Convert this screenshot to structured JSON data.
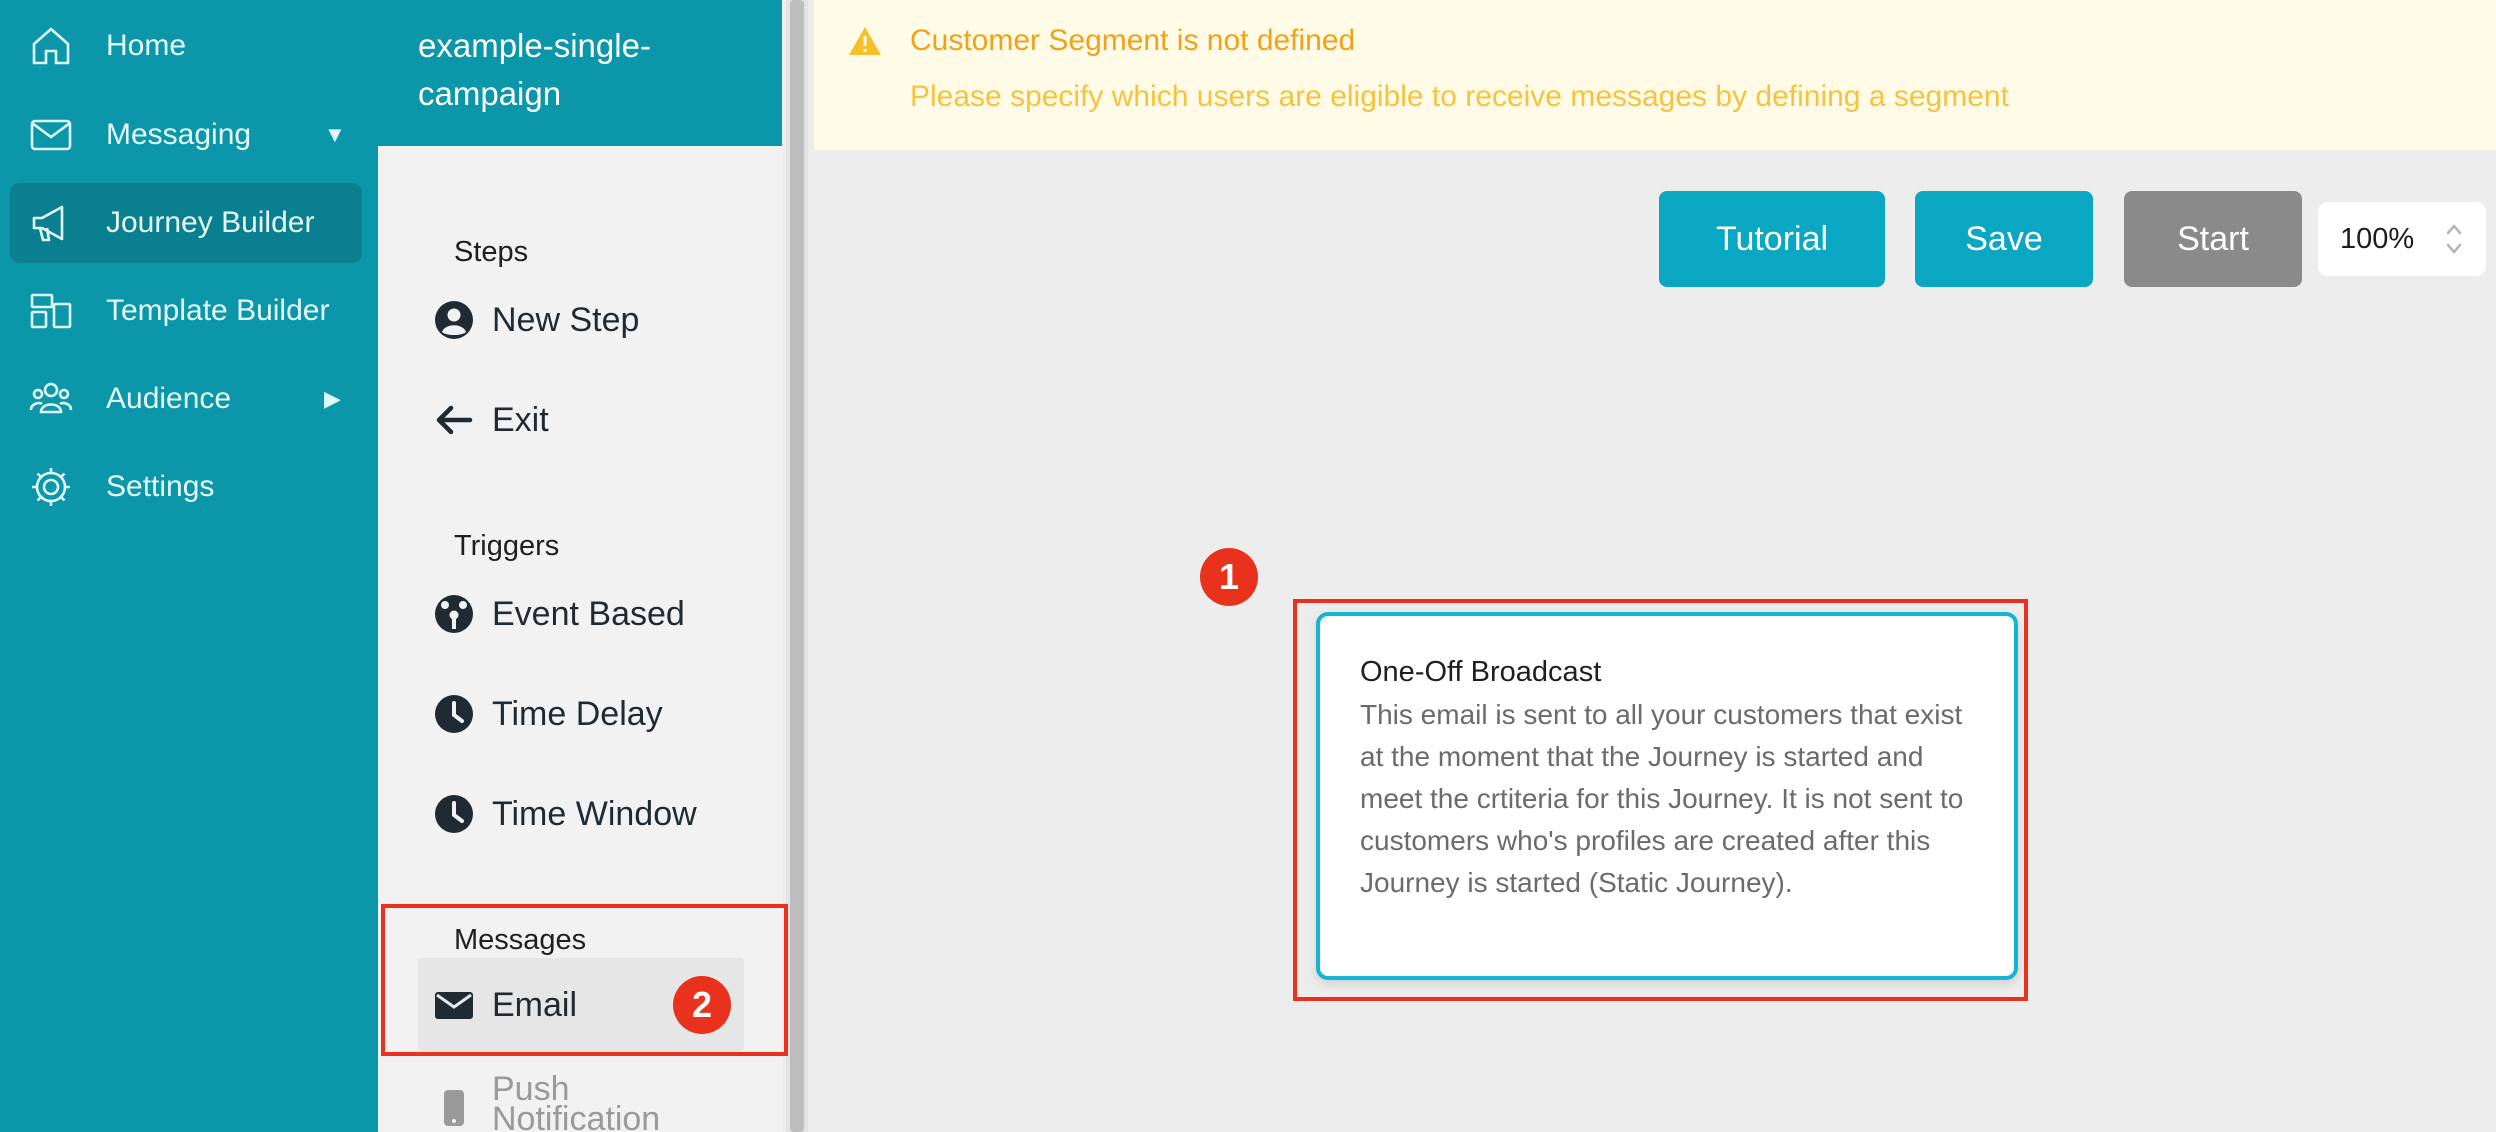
{
  "nav": {
    "items": [
      {
        "label": "Home",
        "icon": "home-icon"
      },
      {
        "label": "Messaging",
        "icon": "mail-icon",
        "arrow": "▼"
      },
      {
        "label": "Journey Builder",
        "icon": "megaphone-icon",
        "active": true
      },
      {
        "label": "Template Builder",
        "icon": "template-icon"
      },
      {
        "label": "Audience",
        "icon": "people-icon",
        "arrow": "▶"
      },
      {
        "label": "Settings",
        "icon": "gear-icon"
      }
    ]
  },
  "palette": {
    "journey_name": "example-single-campaign",
    "sections": {
      "steps": "Steps",
      "triggers": "Triggers",
      "messages": "Messages"
    },
    "items": {
      "new_step": "New Step",
      "exit": "Exit",
      "event_based": "Event Based",
      "time_delay": "Time Delay",
      "time_window": "Time Window",
      "email": "Email",
      "push_notification": "Push Notification"
    }
  },
  "alert": {
    "title": "Customer Segment is not defined",
    "description": "Please specify which users are eligible to receive messages by defining a segment"
  },
  "toolbar": {
    "tutorial": "Tutorial",
    "save": "Save",
    "start": "Start",
    "zoom": "100%"
  },
  "node": {
    "title": "One-Off Broadcast",
    "description": "This email is sent to all your customers that exist at the moment that the Journey is started and meet the crtiteria for this Journey. It is not sent to customers who's profiles are created after this Journey is started (Static Journey)."
  },
  "annotations": {
    "badge1": "1",
    "badge2": "2"
  },
  "colors": {
    "brand": "#0b97a9",
    "button": "#0aa7c2",
    "alert_text": "#f2a21a",
    "highlight": "#e8321d"
  }
}
